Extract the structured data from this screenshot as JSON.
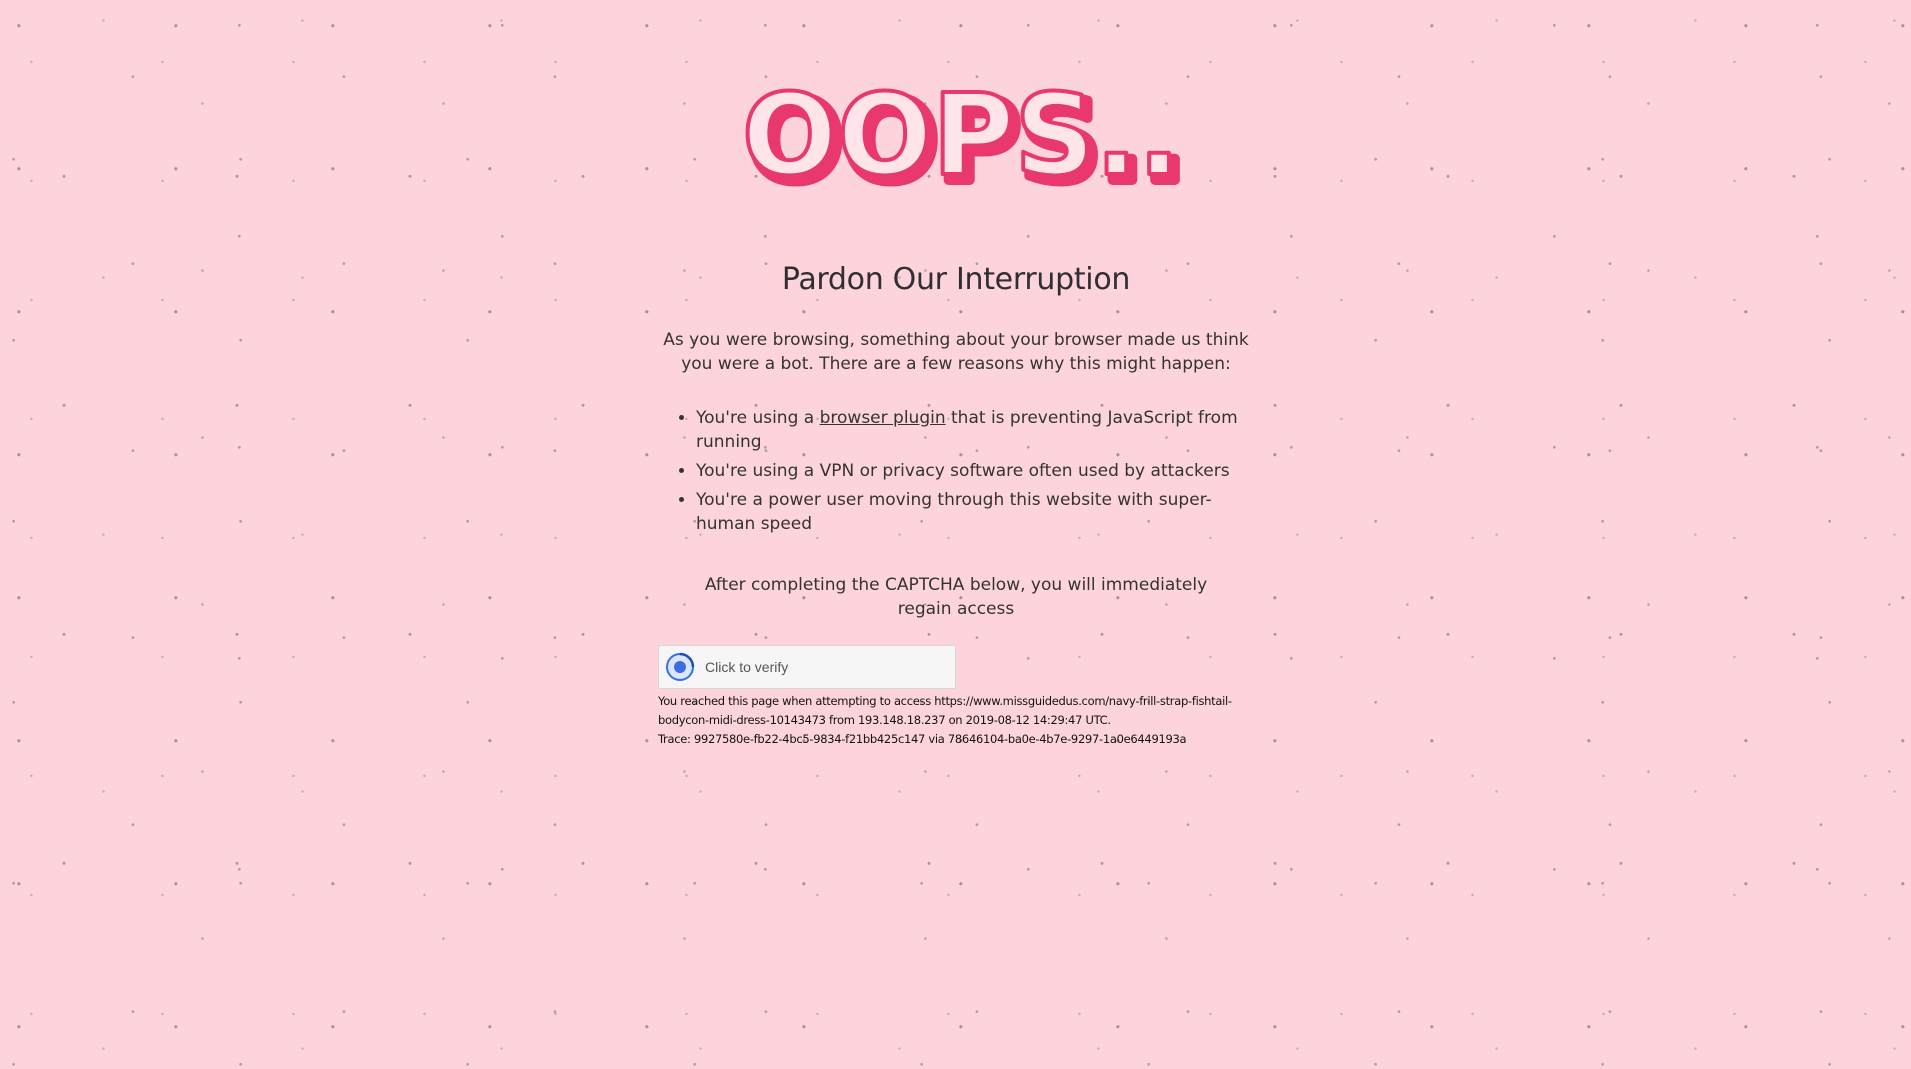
{
  "logo": {
    "text": "OOPS...",
    "fill_color": "#ffe4ea",
    "shade_color": "#e8386e"
  },
  "page": {
    "title": "Pardon Our Interruption",
    "intro": "As you were browsing, something about your browser made us think you were a bot. There are a few reasons why this might happen:",
    "reasons": [
      {
        "before": "You're using a ",
        "link": "browser plugin",
        "after": " that is preventing JavaScript from running"
      },
      {
        "text": "You're using a VPN or privacy software often used by attackers"
      },
      {
        "text": "You're a power user moving through this website with super-human speed"
      }
    ],
    "after_captcha": "After completing the CAPTCHA below, you will immediately regain access"
  },
  "captcha": {
    "label": "Click to verify",
    "icon": "radio-spinner-icon",
    "accent": "#3b6fe0"
  },
  "footer": {
    "access_line": "You reached this page when attempting to access https://www.missguidedus.com/navy-frill-strap-fishtail-bodycon-midi-dress-10143473 from 193.148.18.237 on 2019-08-12 14:29:47 UTC.",
    "trace_line": "Trace: 9927580e-fb22-4bc5-9834-f21bb425c147 via 78646104-ba0e-4b7e-9297-1a0e6449193a"
  },
  "colors": {
    "background": "#fdd4dc",
    "text": "#333333"
  }
}
